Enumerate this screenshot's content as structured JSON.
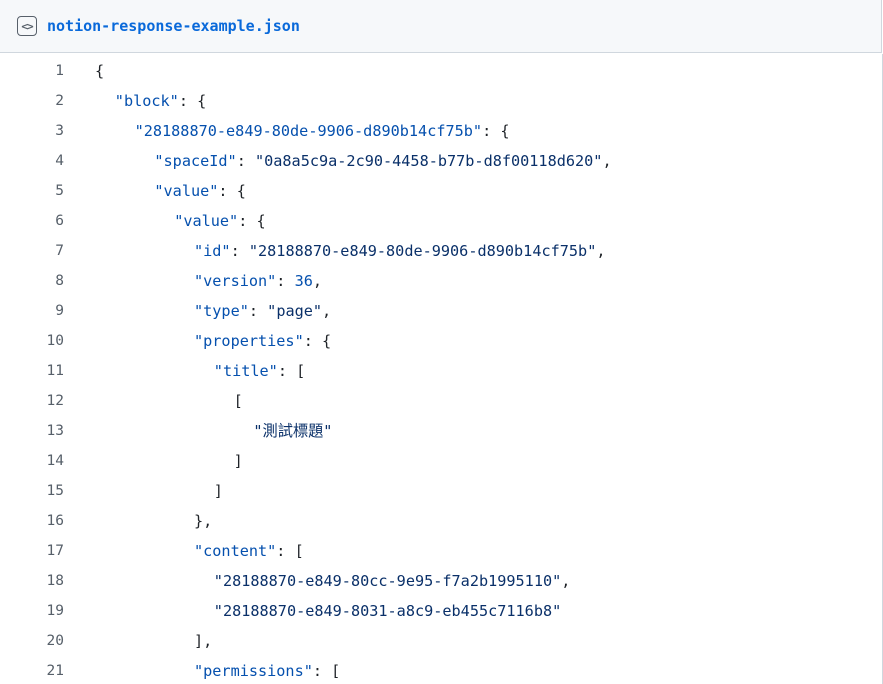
{
  "file": {
    "name": "notion-response-example.json",
    "icon": "code-file-icon",
    "icon_glyph": "<>"
  },
  "colors": {
    "key": "#0550ae",
    "string": "#0a3069",
    "number": "#0550ae",
    "punct": "#1f2328",
    "line_number": "#57606a",
    "link": "#0969da"
  },
  "lines": [
    {
      "n": "1",
      "indent": 0,
      "parts": [
        {
          "t": "{",
          "c": "p"
        }
      ]
    },
    {
      "n": "2",
      "indent": 2,
      "parts": [
        {
          "t": "\"block\"",
          "c": "k"
        },
        {
          "t": ": {",
          "c": "p"
        }
      ]
    },
    {
      "n": "3",
      "indent": 4,
      "parts": [
        {
          "t": "\"28188870-e849-80de-9906-d890b14cf75b\"",
          "c": "k"
        },
        {
          "t": ": {",
          "c": "p"
        }
      ]
    },
    {
      "n": "4",
      "indent": 6,
      "parts": [
        {
          "t": "\"spaceId\"",
          "c": "k"
        },
        {
          "t": ": ",
          "c": "p"
        },
        {
          "t": "\"0a8a5c9a-2c90-4458-b77b-d8f00118d620\"",
          "c": "s"
        },
        {
          "t": ",",
          "c": "p"
        }
      ]
    },
    {
      "n": "5",
      "indent": 6,
      "parts": [
        {
          "t": "\"value\"",
          "c": "k"
        },
        {
          "t": ": {",
          "c": "p"
        }
      ]
    },
    {
      "n": "6",
      "indent": 8,
      "parts": [
        {
          "t": "\"value\"",
          "c": "k"
        },
        {
          "t": ": {",
          "c": "p"
        }
      ]
    },
    {
      "n": "7",
      "indent": 10,
      "parts": [
        {
          "t": "\"id\"",
          "c": "k"
        },
        {
          "t": ": ",
          "c": "p"
        },
        {
          "t": "\"28188870-e849-80de-9906-d890b14cf75b\"",
          "c": "s"
        },
        {
          "t": ",",
          "c": "p"
        }
      ]
    },
    {
      "n": "8",
      "indent": 10,
      "parts": [
        {
          "t": "\"version\"",
          "c": "k"
        },
        {
          "t": ": ",
          "c": "p"
        },
        {
          "t": "36",
          "c": "n"
        },
        {
          "t": ",",
          "c": "p"
        }
      ]
    },
    {
      "n": "9",
      "indent": 10,
      "parts": [
        {
          "t": "\"type\"",
          "c": "k"
        },
        {
          "t": ": ",
          "c": "p"
        },
        {
          "t": "\"page\"",
          "c": "s"
        },
        {
          "t": ",",
          "c": "p"
        }
      ]
    },
    {
      "n": "10",
      "indent": 10,
      "parts": [
        {
          "t": "\"properties\"",
          "c": "k"
        },
        {
          "t": ": {",
          "c": "p"
        }
      ]
    },
    {
      "n": "11",
      "indent": 12,
      "parts": [
        {
          "t": "\"title\"",
          "c": "k"
        },
        {
          "t": ": [",
          "c": "p"
        }
      ]
    },
    {
      "n": "12",
      "indent": 14,
      "parts": [
        {
          "t": "[",
          "c": "p"
        }
      ]
    },
    {
      "n": "13",
      "indent": 16,
      "parts": [
        {
          "t": "\"測試標題\"",
          "c": "s"
        }
      ]
    },
    {
      "n": "14",
      "indent": 14,
      "parts": [
        {
          "t": "]",
          "c": "p"
        }
      ]
    },
    {
      "n": "15",
      "indent": 12,
      "parts": [
        {
          "t": "]",
          "c": "p"
        }
      ]
    },
    {
      "n": "16",
      "indent": 10,
      "parts": [
        {
          "t": "},",
          "c": "p"
        }
      ]
    },
    {
      "n": "17",
      "indent": 10,
      "parts": [
        {
          "t": "\"content\"",
          "c": "k"
        },
        {
          "t": ": [",
          "c": "p"
        }
      ]
    },
    {
      "n": "18",
      "indent": 12,
      "parts": [
        {
          "t": "\"28188870-e849-80cc-9e95-f7a2b1995110\"",
          "c": "s"
        },
        {
          "t": ",",
          "c": "p"
        }
      ]
    },
    {
      "n": "19",
      "indent": 12,
      "parts": [
        {
          "t": "\"28188870-e849-8031-a8c9-eb455c7116b8\"",
          "c": "s"
        }
      ]
    },
    {
      "n": "20",
      "indent": 10,
      "parts": [
        {
          "t": "],",
          "c": "p"
        }
      ]
    },
    {
      "n": "21",
      "indent": 10,
      "parts": [
        {
          "t": "\"permissions\"",
          "c": "k"
        },
        {
          "t": ": [",
          "c": "p"
        }
      ]
    }
  ]
}
